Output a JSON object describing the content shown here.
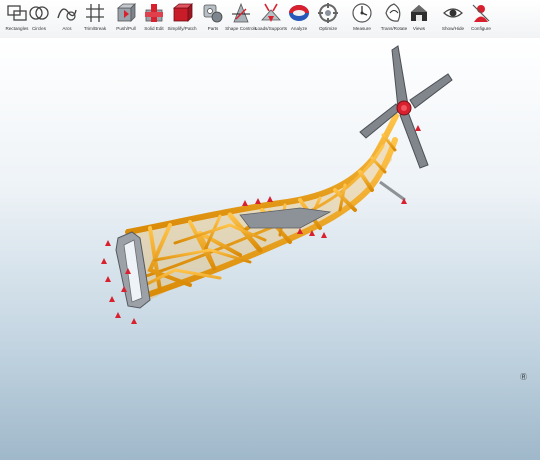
{
  "toolbar": {
    "tools": [
      {
        "label": "Rectangles",
        "icon": "rectangles-icon"
      },
      {
        "label": "Circles",
        "icon": "circles-icon"
      },
      {
        "label": "Arcs",
        "icon": "arcs-icon"
      },
      {
        "label": "Trim/Break",
        "icon": "trim-break-icon"
      },
      {
        "label": "Push/Pull",
        "icon": "push-pull-icon"
      },
      {
        "label": "Solid Edit",
        "icon": "solid-edit-icon"
      },
      {
        "label": "Simplify/Patch",
        "icon": "simplify-patch-icon"
      },
      {
        "label": "Parts",
        "icon": "parts-icon"
      },
      {
        "label": "Shape Controls",
        "icon": "shape-controls-icon"
      },
      {
        "label": "Loads/Supports",
        "icon": "loads-supports-icon"
      },
      {
        "label": "Analyze",
        "icon": "analyze-icon"
      },
      {
        "label": "Optimize",
        "icon": "optimize-icon"
      },
      {
        "label": "Measure",
        "icon": "measure-icon"
      },
      {
        "label": "Trans/Rotate",
        "icon": "trans-rotate-icon"
      },
      {
        "label": "Views",
        "icon": "views-icon"
      },
      {
        "label": "Show/Hide",
        "icon": "show-hide-icon"
      },
      {
        "label": "Configure",
        "icon": "configure-icon"
      }
    ]
  },
  "viewport": {
    "model": "helicopter-frame-optimized",
    "accent_color": "#f0a010",
    "support_color": "#d8202e",
    "triad_label": "Ⓡ"
  }
}
